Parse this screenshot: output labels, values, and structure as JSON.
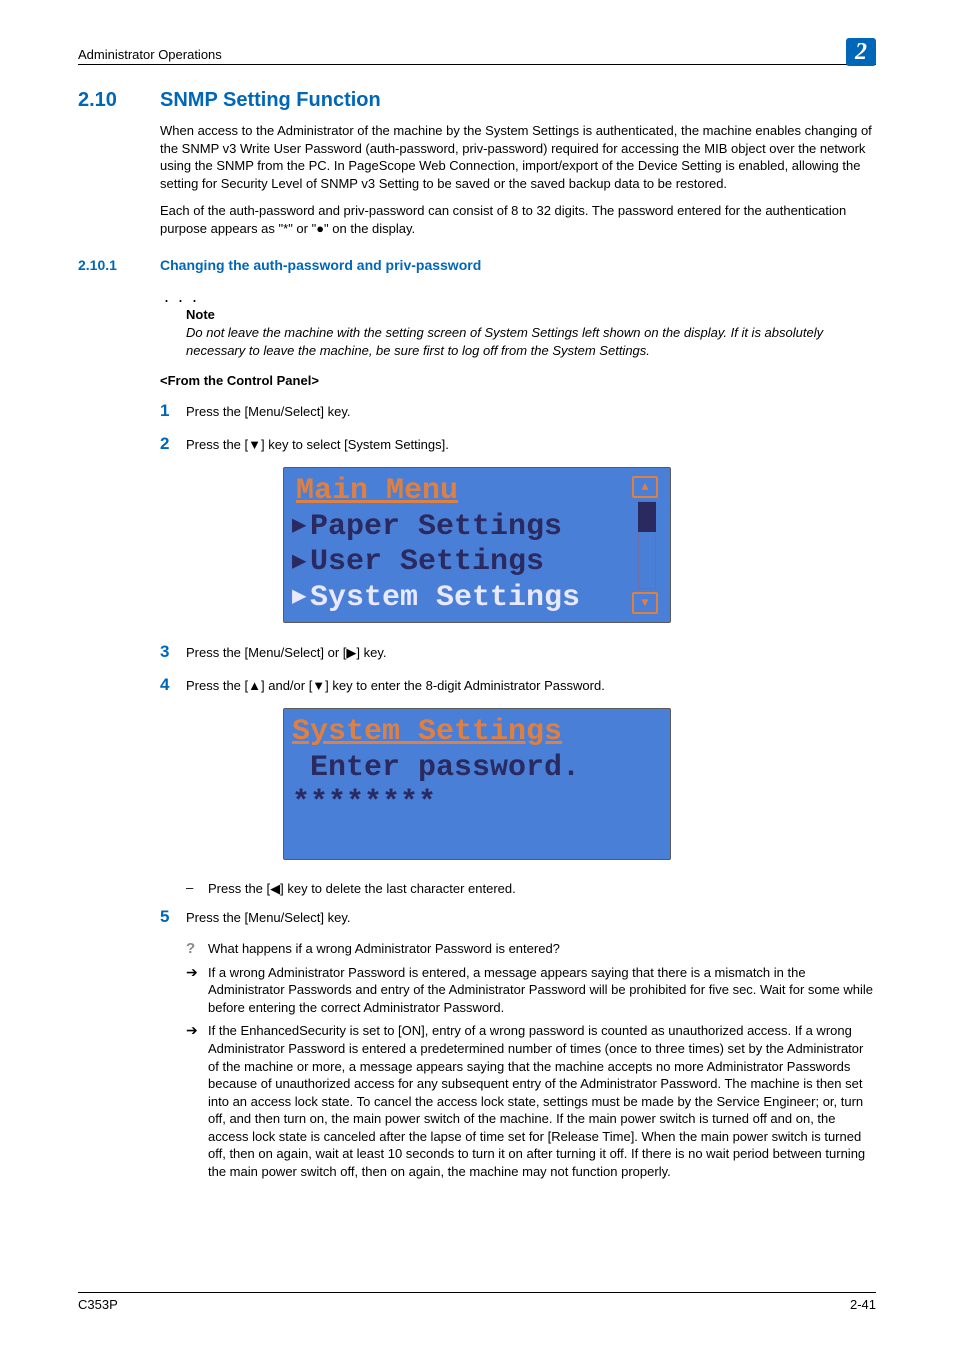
{
  "header": {
    "title": "Administrator Operations",
    "chapter": "2"
  },
  "section": {
    "num": "2.10",
    "title": "SNMP Setting Function"
  },
  "para1": "When access to the Administrator of the machine by the System Settings is authenticated, the machine enables changing of the SNMP v3 Write User Password (auth-password, priv-password) required for accessing the MIB object over the network using the SNMP from the PC. In PageScope Web Connection, import/export of the Device Setting is enabled, allowing the setting for Security Level of SNMP v3 Setting to be saved or the saved backup data to be restored.",
  "para2": "Each of the auth-password and priv-password can consist of 8 to 32 digits. The password entered for the authentication purpose appears as \"*\" or \"●\" on the display.",
  "subsection": {
    "num": "2.10.1",
    "title": "Changing the auth-password and priv-password"
  },
  "note": {
    "label": "Note",
    "text": "Do not leave the machine with the setting screen of System Settings left shown on the display. If it is absolutely necessary to leave the machine, be sure first to log off from the System Settings."
  },
  "panel_heading": "<From the Control Panel>",
  "steps": {
    "s1": "Press the [Menu/Select] key.",
    "s2": "Press the [▼] key to select [System Settings].",
    "s3": "Press the [Menu/Select] or [▶] key.",
    "s4": "Press the [▲] and/or [▼] key to enter the 8-digit Administrator Password.",
    "s4_sub": "Press the [◀] key to delete the last character entered.",
    "s5": "Press the [Menu/Select] key.",
    "s5_q": "What happens if a wrong Administrator Password is entered?",
    "s5_a1": "If a wrong Administrator Password is entered, a message appears saying that there is a mismatch in the Administrator Passwords and entry of the Administrator Password will be prohibited for five sec. Wait for some while before entering the correct Administrator Password.",
    "s5_a2": "If the EnhancedSecurity is set to [ON], entry of a wrong password is counted as unauthorized access. If a wrong Administrator Password is entered a predetermined number of times (once to three times) set by the Administrator of the machine or more, a message appears saying that the machine accepts no more Administrator Passwords because of unauthorized access for any subsequent entry of the Administrator Password. The machine is then set into an access lock state. To cancel the access lock state, settings must be made by the Service Engineer; or, turn off, and then turn on, the main power switch of the machine. If the main power switch is turned off and on, the access lock state is canceled after the lapse of time set for [Release Time]. When the main power switch is turned off, then on again, wait at least 10 seconds to turn it on after turning it off. If there is no wait period between turning the main power switch off, then on again, the machine may not function properly."
  },
  "screen1": {
    "title": "Main Menu",
    "item1": "Paper Settings",
    "item2": "User Settings",
    "item3": "System Settings"
  },
  "screen2": {
    "title": "System Settings",
    "line1": "Enter password.",
    "line2": "********"
  },
  "footer": {
    "left": "C353P",
    "right": "2-41"
  }
}
